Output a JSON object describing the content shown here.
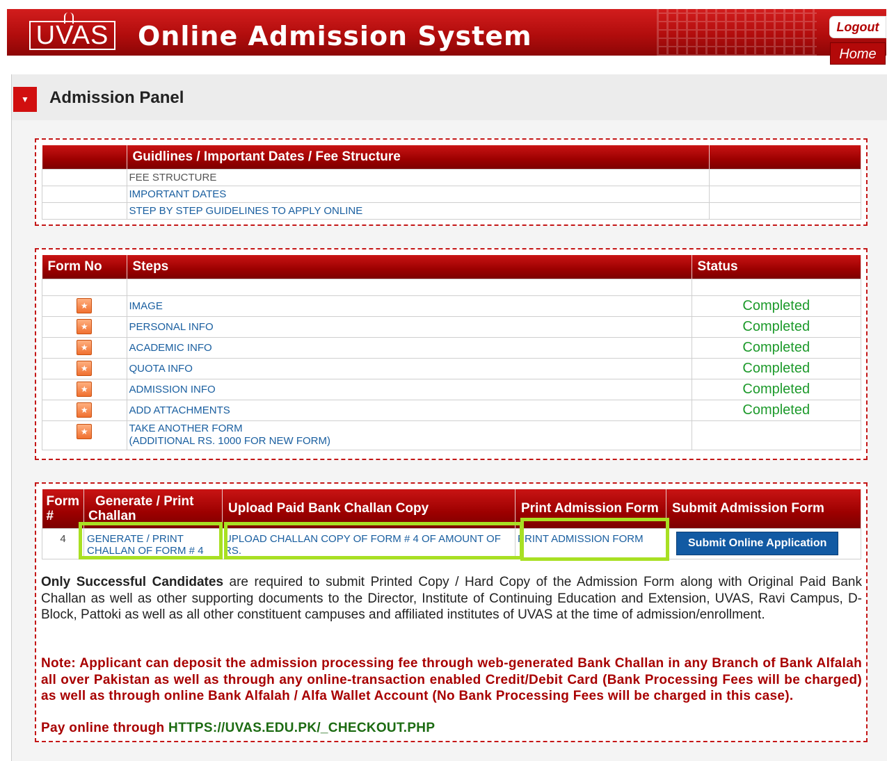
{
  "header": {
    "logo_text": "UVAS",
    "title": "Online Admission System",
    "logout_label": "Logout",
    "home_label": "Home"
  },
  "panel": {
    "toggle_symbol": "▼",
    "title": "Admission Panel"
  },
  "guidelines": {
    "heading": "Guidlines / Important Dates / Fee Structure",
    "links": [
      "FEE STRUCTURE",
      "IMPORTANT DATES",
      "STEP BY STEP GUIDELINES TO APPLY ONLINE"
    ]
  },
  "steps": {
    "headers": {
      "form_no": "Form No",
      "steps": "Steps",
      "status": "Status"
    },
    "rows": [
      {
        "label": "IMAGE",
        "status": "Completed"
      },
      {
        "label": "PERSONAL INFO",
        "status": "Completed"
      },
      {
        "label": "ACADEMIC INFO",
        "status": "Completed"
      },
      {
        "label": "QUOTA INFO",
        "status": "Completed"
      },
      {
        "label": "ADMISSION INFO",
        "status": "Completed"
      },
      {
        "label": "ADD ATTACHMENTS",
        "status": "Completed"
      },
      {
        "label": "TAKE ANOTHER FORM",
        "label2": "(ADDITIONAL RS. 1000 FOR NEW FORM)",
        "status": ""
      }
    ]
  },
  "forms": {
    "headers": {
      "form_no": "Form #",
      "form_no_a": "Form",
      "form_no_b": "#",
      "challan_a": "Generate / Print",
      "challan_b": "Challan",
      "upload": "Upload Paid Bank Challan Copy",
      "print": "Print Admission Form",
      "submit": "Submit Admission Form"
    },
    "row": {
      "form_no": "4",
      "challan_link_a": "GENERATE / PRINT",
      "challan_link_b": "CHALLAN OF FORM # 4",
      "upload_link_a": "UPLOAD CHALLAN COPY OF FORM # 4 OF AMOUNT OF",
      "upload_link_b": "RS.",
      "print_link": "PRINT ADMISSION FORM",
      "submit_button": "Submit Online Application"
    }
  },
  "info": {
    "bold_lead": "Only Successful Candidates",
    "text": " are required to submit Printed Copy / Hard Copy of the Admission Form along with Original Paid Bank Challan as well as other supporting documents to the Director, Institute of Continuing Education and Extension, UVAS, Ravi Campus, D-Block, Pattoki as well as all other constituent campuses and affiliated institutes of UVAS at the time of admission/enrollment.",
    "note": "Note: Applicant can deposit the admission processing fee through web-generated Bank Challan in any Branch of Bank Alfalah all over Pakistan as well as through any online-transaction enabled Credit/Debit Card (Bank Processing Fees will be charged) as well as through online Bank Alfalah / Alfa Wallet Account (No Bank Processing Fees will be charged in this case).",
    "pay_prefix": "Pay online through ",
    "pay_url": "HTTPS://UVAS.EDU.PK/_CHECKOUT.PHP"
  },
  "colors": {
    "header_red": "#b20d0d",
    "status_green": "#1d9a2b",
    "highlight_green": "#a8e023",
    "submit_blue": "#125aa3"
  }
}
